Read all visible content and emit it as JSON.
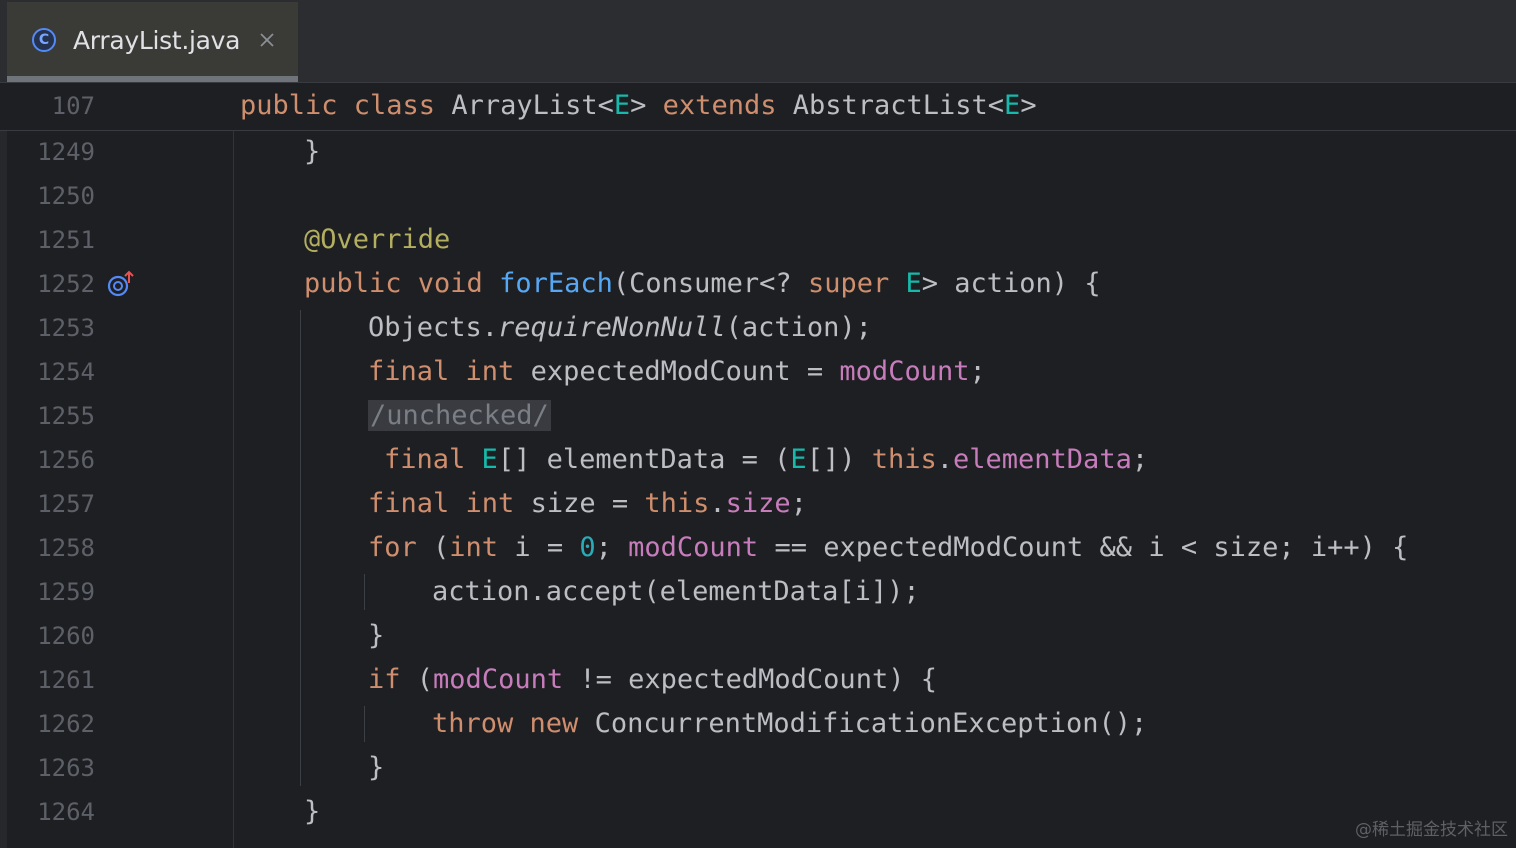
{
  "tab": {
    "title": "ArrayList.java",
    "icon": "class-c-icon",
    "close_icon": "close-icon"
  },
  "sticky": {
    "line_number": "107",
    "code": [
      {
        "t": "public class ",
        "c": "kw"
      },
      {
        "t": "ArrayList<",
        "c": ""
      },
      {
        "t": "E",
        "c": "tp"
      },
      {
        "t": "> ",
        "c": ""
      },
      {
        "t": "extends ",
        "c": "kw"
      },
      {
        "t": "AbstractList<",
        "c": ""
      },
      {
        "t": "E",
        "c": "tp"
      },
      {
        "t": ">",
        "c": ""
      }
    ]
  },
  "lines": [
    {
      "n": "1249",
      "indent": 0,
      "code": [
        {
          "t": "}",
          "c": ""
        }
      ]
    },
    {
      "n": "1250",
      "indent": 0,
      "code": []
    },
    {
      "n": "1251",
      "indent": 0,
      "code": [
        {
          "t": "@Override",
          "c": "ann"
        }
      ]
    },
    {
      "n": "1252",
      "indent": 0,
      "icon": "override-method-icon",
      "code": [
        {
          "t": "public void ",
          "c": "kw"
        },
        {
          "t": "forEach",
          "c": "fn"
        },
        {
          "t": "(Consumer<? ",
          "c": ""
        },
        {
          "t": "super ",
          "c": "kw"
        },
        {
          "t": "E",
          "c": "tp"
        },
        {
          "t": "> action) {",
          "c": ""
        }
      ]
    },
    {
      "n": "1253",
      "indent": 1,
      "code": [
        {
          "t": "Objects.",
          "c": ""
        },
        {
          "t": "requireNonNull",
          "c": "it"
        },
        {
          "t": "(action);",
          "c": ""
        }
      ]
    },
    {
      "n": "1254",
      "indent": 1,
      "code": [
        {
          "t": "final int ",
          "c": "kw"
        },
        {
          "t": "expectedModCount = ",
          "c": ""
        },
        {
          "t": "modCount",
          "c": "fld"
        },
        {
          "t": ";",
          "c": ""
        }
      ]
    },
    {
      "n": "1255",
      "indent": 1,
      "code": [
        {
          "t": "/unchecked/",
          "c": "folded"
        }
      ]
    },
    {
      "n": "1256",
      "indent": 1,
      "pre": " ",
      "code": [
        {
          "t": "final ",
          "c": "kw"
        },
        {
          "t": "E",
          "c": "tp"
        },
        {
          "t": "[] elementData = (",
          "c": ""
        },
        {
          "t": "E",
          "c": "tp"
        },
        {
          "t": "[]) ",
          "c": ""
        },
        {
          "t": "this",
          "c": "kw"
        },
        {
          "t": ".",
          "c": ""
        },
        {
          "t": "elementData",
          "c": "fld"
        },
        {
          "t": ";",
          "c": ""
        }
      ]
    },
    {
      "n": "1257",
      "indent": 1,
      "code": [
        {
          "t": "final int ",
          "c": "kw"
        },
        {
          "t": "size = ",
          "c": ""
        },
        {
          "t": "this",
          "c": "kw"
        },
        {
          "t": ".",
          "c": ""
        },
        {
          "t": "size",
          "c": "fld"
        },
        {
          "t": ";",
          "c": ""
        }
      ]
    },
    {
      "n": "1258",
      "indent": 1,
      "code": [
        {
          "t": "for ",
          "c": "kw"
        },
        {
          "t": "(",
          "c": ""
        },
        {
          "t": "int ",
          "c": "kw"
        },
        {
          "t": "i = ",
          "c": ""
        },
        {
          "t": "0",
          "c": "num"
        },
        {
          "t": "; ",
          "c": ""
        },
        {
          "t": "modCount",
          "c": "fld"
        },
        {
          "t": " == expectedModCount && i < size; i++) {",
          "c": ""
        }
      ]
    },
    {
      "n": "1259",
      "indent": 2,
      "code": [
        {
          "t": "action.accept(elementData[i]);",
          "c": ""
        }
      ]
    },
    {
      "n": "1260",
      "indent": 1,
      "code": [
        {
          "t": "}",
          "c": ""
        }
      ]
    },
    {
      "n": "1261",
      "indent": 1,
      "code": [
        {
          "t": "if ",
          "c": "kw"
        },
        {
          "t": "(",
          "c": ""
        },
        {
          "t": "modCount",
          "c": "fld"
        },
        {
          "t": " != expectedModCount) {",
          "c": ""
        }
      ]
    },
    {
      "n": "1262",
      "indent": 2,
      "code": [
        {
          "t": "throw new ",
          "c": "kw"
        },
        {
          "t": "ConcurrentModificationException();",
          "c": ""
        }
      ]
    },
    {
      "n": "1263",
      "indent": 1,
      "code": [
        {
          "t": "}",
          "c": ""
        }
      ]
    },
    {
      "n": "1264",
      "indent": 0,
      "code": [
        {
          "t": "}",
          "c": ""
        }
      ]
    }
  ],
  "watermark": "@稀土掘金技术社区",
  "colors": {
    "background": "#1e1f22",
    "keyword": "#cf8e6d",
    "function": "#56a8f5",
    "type_param": "#16baac",
    "field": "#c77dbb",
    "annotation": "#b3ae60",
    "number": "#2aacb8"
  }
}
